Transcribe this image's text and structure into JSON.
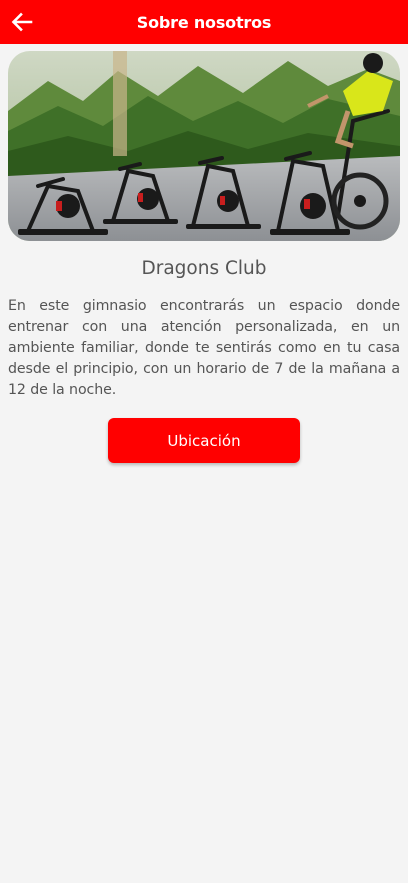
{
  "header": {
    "title": "Sobre nosotros",
    "back_icon": "arrow-left-icon",
    "background_color": "#ff0000"
  },
  "hero": {
    "image_subject": "indoor cycling bikes in front of green mountain mural"
  },
  "club": {
    "name": "Dragons Club",
    "description": "En este gimnasio encontrarás un espacio donde entrenar con una atención personalizada, en un ambiente familiar, donde te sentirás como en tu casa desde el principio, con un horario de 7 de la mañana a 12 de la noche."
  },
  "actions": {
    "location_label": "Ubicación",
    "button_color": "#ff0000"
  }
}
